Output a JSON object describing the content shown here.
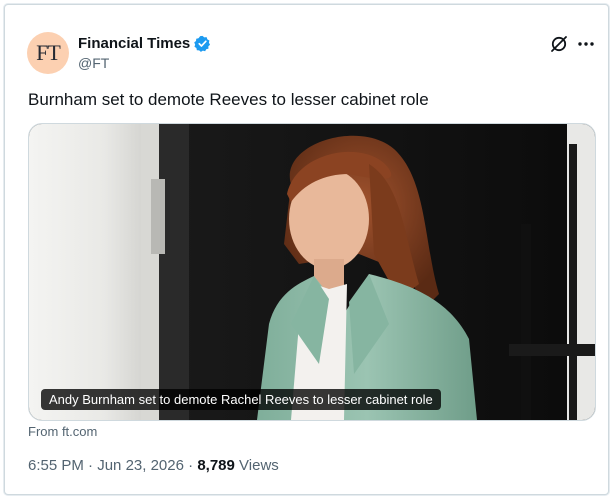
{
  "post": {
    "author_initials": "FT",
    "display_name": "Financial Times",
    "handle": "@FT",
    "text": "Burnham set to demote Reeves to lesser cabinet role",
    "media_caption": "Andy Burnham set to demote Rachel Reeves to lesser cabinet role",
    "source": "From ft.com",
    "time": "6:55 PM",
    "separator": "·",
    "date": "Jun 23, 2026",
    "views_count": "8,789",
    "views_label": "Views"
  },
  "icons": {
    "verified": "verified-badge-icon",
    "grok": "grok-icon",
    "more": "more-options-icon"
  },
  "colors": {
    "avatar_bg": "#fcd0b1",
    "verified_blue": "#1d9bf0",
    "text_primary": "#0f1419",
    "text_secondary": "#536471",
    "coat": "#8fb9a6"
  }
}
